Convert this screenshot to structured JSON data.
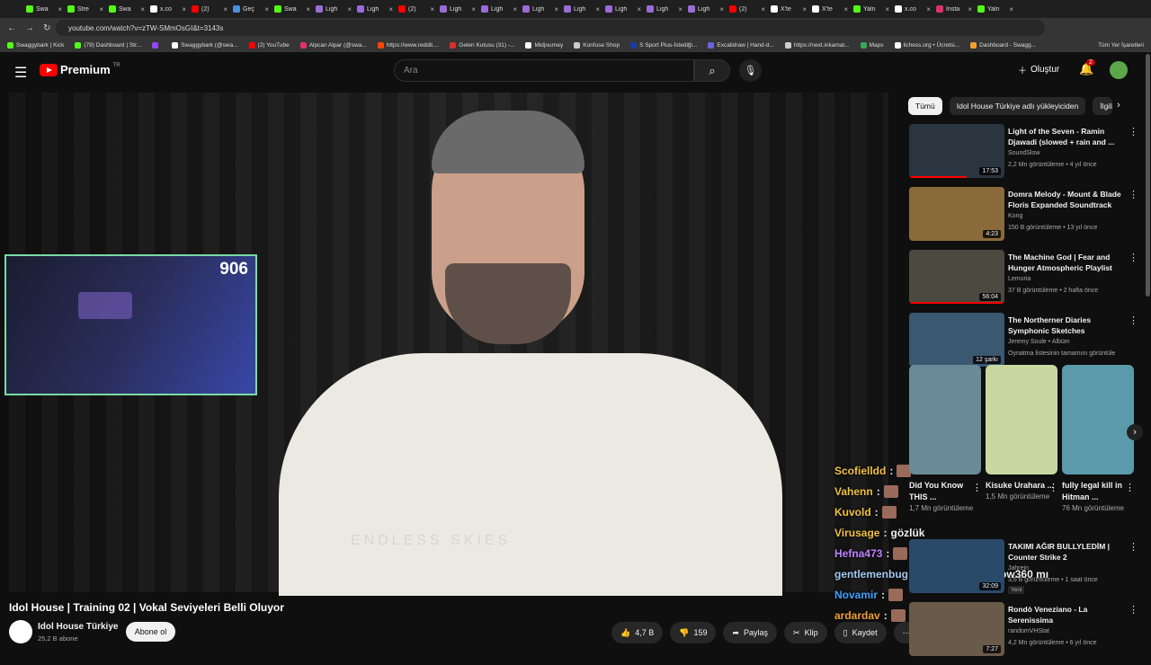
{
  "browser": {
    "tabs": [
      {
        "label": "Swa",
        "color": "#53fc18"
      },
      {
        "label": "Stre",
        "color": "#53fc18"
      },
      {
        "label": "Swa",
        "color": "#53fc18"
      },
      {
        "label": "x.co",
        "color": "#ffffff"
      },
      {
        "label": "(2)",
        "color": "#ff0000"
      },
      {
        "label": "Geç",
        "color": "#4a90d9"
      },
      {
        "label": "Swa",
        "color": "#53fc18"
      },
      {
        "label": "Ligh",
        "color": "#9b6bd8"
      },
      {
        "label": "Ligh",
        "color": "#9b6bd8"
      },
      {
        "label": "(2)",
        "color": "#ff0000"
      },
      {
        "label": "Ligh",
        "color": "#9b6bd8"
      },
      {
        "label": "Ligh",
        "color": "#9b6bd8"
      },
      {
        "label": "Ligh",
        "color": "#9b6bd8"
      },
      {
        "label": "Ligh",
        "color": "#9b6bd8"
      },
      {
        "label": "Ligh",
        "color": "#9b6bd8"
      },
      {
        "label": "Ligh",
        "color": "#9b6bd8"
      },
      {
        "label": "Ligh",
        "color": "#9b6bd8"
      },
      {
        "label": "(2)",
        "color": "#ff0000"
      },
      {
        "label": "X'te",
        "color": "#ffffff"
      },
      {
        "label": "X'te",
        "color": "#ffffff"
      },
      {
        "label": "Yaln",
        "color": "#53fc18"
      },
      {
        "label": "x.co",
        "color": "#ffffff"
      },
      {
        "label": "Insta",
        "color": "#e1306c"
      },
      {
        "label": "Yaln",
        "color": "#53fc18"
      }
    ],
    "url": "youtube.com/watch?v=zTW-SMmOsGI&t=3143s",
    "bookmarks": [
      {
        "label": "Swaggybark | Kick",
        "color": "#53fc18"
      },
      {
        "label": "(79) Dashboard | Str...",
        "color": "#53fc18"
      },
      {
        "label": "",
        "color": "#9146ff"
      },
      {
        "label": "Swaggybark (@swa...",
        "color": "#ffffff"
      },
      {
        "label": "(2) YouTube",
        "color": "#ff0000"
      },
      {
        "label": "Alpcan Alpar (@swa...",
        "color": "#e1306c"
      },
      {
        "label": "https://www.reddit....",
        "color": "#ff4500"
      },
      {
        "label": "Gelen Kutusu (31) -...",
        "color": "#d93025"
      },
      {
        "label": "Midjourney",
        "color": "#ffffff"
      },
      {
        "label": "Konfuse Shop",
        "color": "#cccccc"
      },
      {
        "label": "S Sport Plus-İstediği...",
        "color": "#1a3aa8"
      },
      {
        "label": "Excalidraw | Hand-d...",
        "color": "#6965db"
      },
      {
        "label": "https://next.inkamat...",
        "color": "#cccccc"
      },
      {
        "label": "Maps",
        "color": "#34a853"
      },
      {
        "label": "lichess.org • Ücretsi...",
        "color": "#ffffff"
      },
      {
        "label": "Dashboard - Swagg...",
        "color": "#f0a030"
      }
    ],
    "all_bookmarks": "Tüm Yer İşaretleri"
  },
  "header": {
    "logo": "Premium",
    "country": "TR",
    "search_placeholder": "Ara",
    "create_label": "Oluştur",
    "notif_count": "2"
  },
  "player": {
    "webcam_count": "906",
    "shirt_text": "ENDLESS SKIES"
  },
  "chat": [
    {
      "user": "Scofielldd",
      "msg": "",
      "color": "#f0c040"
    },
    {
      "user": "Vahenn",
      "msg": "",
      "color": "#f0c040"
    },
    {
      "user": "Kuvold",
      "msg": "",
      "color": "#f0c040"
    },
    {
      "user": "Virusage",
      "msg": "gözlük",
      "color": "#f0c040"
    },
    {
      "user": "Hefna473",
      "msg": "",
      "color": "#c080ff"
    },
    {
      "user": "gentlemenbug",
      "msg": "ney bu çakma flow360 mı",
      "color": "#a0c8f0"
    },
    {
      "user": "Novamir",
      "msg": "",
      "color": "#40a0ff"
    },
    {
      "user": "ardardav",
      "msg": "",
      "color": "#f0a030"
    }
  ],
  "video": {
    "title": "Idol House | Training 02 | Vokal Seviyeleri Belli Oluyor",
    "channel": "Idol House Türkiye",
    "subs": "25,2 B abone",
    "subscribe": "Abone ol",
    "likes": "4,7 B",
    "dislikes": "159",
    "share": "Paylaş",
    "clip": "Klip",
    "save": "Kaydet"
  },
  "chips": [
    "Tümü",
    "Idol House Türkiye adlı yükleyiciden",
    "İlgili"
  ],
  "recs": [
    {
      "title": "Light of the Seven - Ramin Djawadi (slowed + rain and ...",
      "channel": "SoundSlow",
      "meta": "2,2 Mn görüntüleme • 4 yıl önce",
      "dur": "17:53",
      "progress": 0.6,
      "color": "#2a3540"
    },
    {
      "title": "Domra Melody - Mount & Blade Floris Expanded Soundtrack",
      "channel": "Kong",
      "meta": "150 B görüntüleme • 13 yıl önce",
      "dur": "4:23",
      "progress": 0,
      "color": "#8a6a3a"
    },
    {
      "title": "The Machine God | Fear and Hunger Atmospheric Playlist",
      "channel": "Lemuria",
      "meta": "37 B görüntüleme • 2 hafta önce",
      "dur": "56:04",
      "progress": 1,
      "color": "#4a4a40"
    },
    {
      "title": "The Northerner Diaries Symphonic Sketches",
      "channel": "Jeremy Soule • Albüm",
      "meta": "Oynatma listesinin tamamını görüntüle",
      "dur": "12 şarkı",
      "progress": 0,
      "color": "#3a5870"
    }
  ],
  "shorts": [
    {
      "title": "Did You Know THIS ...",
      "views": "1,7 Mn görüntüleme",
      "color": "#6a8a9a"
    },
    {
      "title": "Kisuke Urahara ...",
      "views": "1,5 Mn görüntüleme",
      "color": "#c8d8a0"
    },
    {
      "title": "fully legal kill in Hitman ...",
      "views": "76 Mn görüntüleme",
      "color": "#5a9aaa"
    }
  ],
  "recs2": [
    {
      "title": "TAKIMI AĞIR BULLYLEDİM | Counter Strike 2",
      "channel": "Jahrein",
      "meta": "3,6 B görüntüleme • 1 saat önce",
      "badge": "Yeni",
      "dur": "32:09",
      "color": "#2a4a6a"
    },
    {
      "title": "Rondò Veneziano - La Serenissima",
      "channel": "randomVHStat",
      "meta": "4,2 Mn görüntüleme • 6 yıl önce",
      "dur": "7:27",
      "color": "#6a5a4a"
    }
  ]
}
